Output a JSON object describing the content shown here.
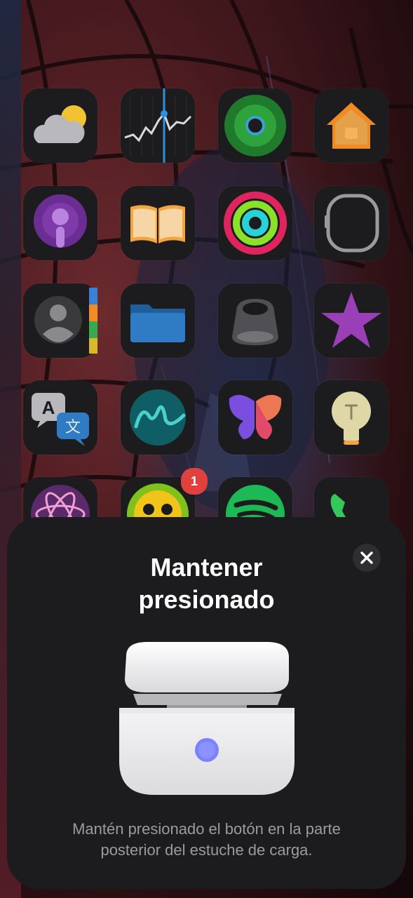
{
  "home_screen": {
    "apps": [
      {
        "name": "weather",
        "icon": "weather-icon"
      },
      {
        "name": "stocks",
        "icon": "stocks-icon"
      },
      {
        "name": "find-my",
        "icon": "find-my-icon"
      },
      {
        "name": "home",
        "icon": "home-icon"
      },
      {
        "name": "podcasts",
        "icon": "podcasts-icon"
      },
      {
        "name": "books",
        "icon": "books-icon"
      },
      {
        "name": "fitness",
        "icon": "fitness-rings-icon"
      },
      {
        "name": "watch",
        "icon": "watch-icon"
      },
      {
        "name": "contacts",
        "icon": "contacts-icon"
      },
      {
        "name": "files",
        "icon": "files-icon"
      },
      {
        "name": "airpods-ear-tip",
        "icon": "ear-tip-icon"
      },
      {
        "name": "itunes-store",
        "icon": "star-icon"
      },
      {
        "name": "translate",
        "icon": "translate-icon"
      },
      {
        "name": "freeform",
        "icon": "freeform-icon"
      },
      {
        "name": "shortcuts-butterfly",
        "icon": "butterfly-icon"
      },
      {
        "name": "tips",
        "icon": "lightbulb-icon"
      },
      {
        "name": "ai-app",
        "icon": "atom-icon"
      },
      {
        "name": "game-app",
        "icon": "game-icon"
      },
      {
        "name": "spotify",
        "icon": "spotify-icon"
      },
      {
        "name": "phone",
        "icon": "phone-icon"
      }
    ],
    "game_badge": "1"
  },
  "sheet": {
    "title_line1": "Mantener",
    "title_line2": "presionado",
    "description_line1": "Mantén presionado el botón en la parte",
    "description_line2": "posterior del estuche de carga.",
    "close_icon": "close-icon"
  },
  "colors": {
    "sheet_bg": "#1c1c1e",
    "button_indicator": "#7b82ff"
  }
}
